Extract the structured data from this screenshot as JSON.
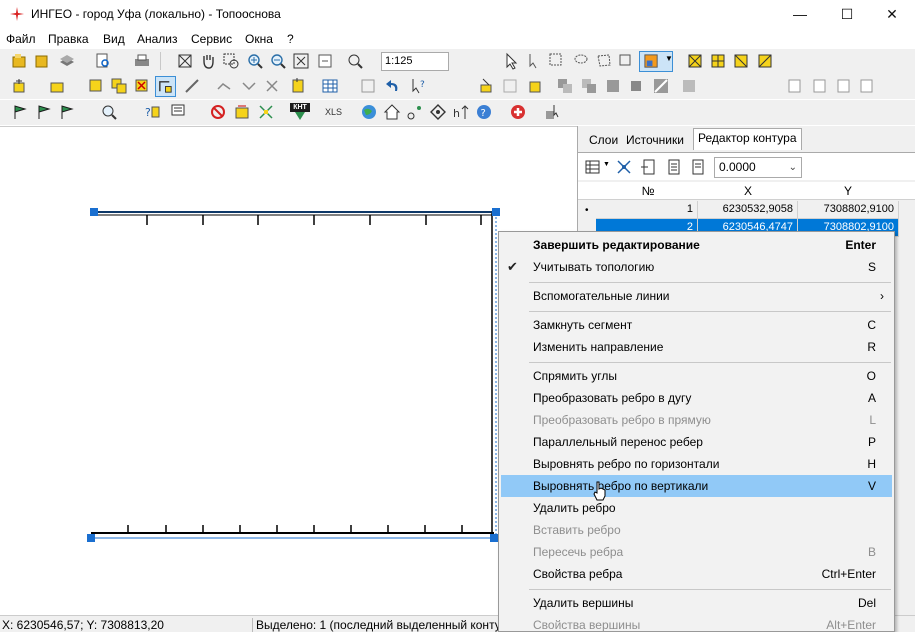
{
  "window": {
    "title": "ИНГЕО - город Уфа (локально) - Топооснова",
    "app_icon": "ingeo-logo-icon",
    "minimize": "—",
    "maximize": "☐",
    "close": "✕"
  },
  "menu": [
    "Файл",
    "Правка",
    "Вид",
    "Анализ",
    "Сервис",
    "Окна",
    "?"
  ],
  "toolbar": {
    "scale_value": "1:125",
    "row3_xls_label": "XLS",
    "row3_knt_label": "КНТ"
  },
  "panel": {
    "tabs": [
      "Слои",
      "Источники",
      "Редактор контура"
    ],
    "active_tab": "Редактор контура",
    "precision_value": "0.0000",
    "grid_headers": [
      "№",
      "X",
      "Y"
    ],
    "rows": [
      {
        "n": "1",
        "x": "6230532,9058",
        "y": "7308802,9100",
        "selected": false
      },
      {
        "n": "2",
        "x": "6230546,4747",
        "y": "7308802,9100",
        "selected": true
      }
    ]
  },
  "context_menu": {
    "items": [
      {
        "label": "Завершить редактирование",
        "key": "Enter",
        "bold": true
      },
      {
        "label": "Учитывать топологию",
        "key": "S",
        "checked": true
      },
      {
        "sep": true
      },
      {
        "label": "Вспомогательные линии",
        "key": "",
        "submenu": true
      },
      {
        "sep": true
      },
      {
        "label": "Замкнуть сегмент",
        "key": "C"
      },
      {
        "label": "Изменить направление",
        "key": "R"
      },
      {
        "sep": true
      },
      {
        "label": "Спрямить углы",
        "key": "O"
      },
      {
        "label": "Преобразовать ребро в дугу",
        "key": "A"
      },
      {
        "label": "Преобразовать ребро в прямую",
        "key": "L",
        "disabled": true
      },
      {
        "label": "Параллельный перенос ребер",
        "key": "P"
      },
      {
        "label": "Выровнять ребро по горизонтали",
        "key": "H"
      },
      {
        "label": "Выровнять ребро по вертикали",
        "key": "V",
        "highlighted": true
      },
      {
        "label": "Удалить ребро",
        "key": ""
      },
      {
        "label": "Вставить ребро",
        "key": "",
        "disabled": true
      },
      {
        "label": "Пересечь ребра",
        "key": "B",
        "disabled": true
      },
      {
        "label": "Свойства ребра",
        "key": "Ctrl+Enter"
      },
      {
        "sep": true
      },
      {
        "label": "Удалить вершины",
        "key": "Del"
      },
      {
        "label": "Свойства вершины",
        "key": "Alt+Enter",
        "disabled": true
      }
    ],
    "checkmark": "✔",
    "submenu_arrow": "›"
  },
  "status": {
    "coords": "X: 6230546,57; Y: 7308813,20",
    "selection": "Выделено: 1 (последний выделенный контур"
  },
  "colors": {
    "selection_blue": "#0078d7",
    "menu_highlight": "#91c9f7",
    "handle_blue": "#1a6fd0"
  }
}
